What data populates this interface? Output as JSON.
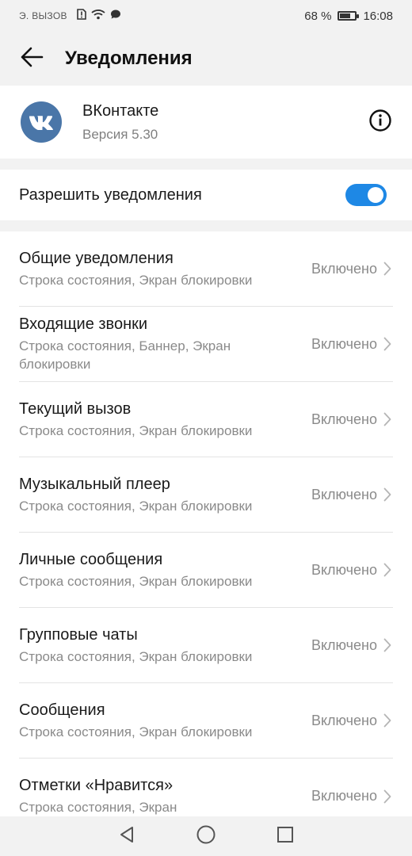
{
  "status_bar": {
    "call_text": "Э. ВЫЗОВ",
    "battery": "68 %",
    "battery_level": 0.68,
    "time": "16:08",
    "icons": [
      "alert-sim-icon",
      "wifi-icon",
      "message-icon"
    ]
  },
  "header": {
    "title": "Уведомления",
    "back_icon": "arrow-left-icon"
  },
  "app": {
    "name": "ВКонтакте",
    "version": "Версия 5.30",
    "icon": "vk-logo-icon",
    "info_icon": "info-icon",
    "brand_color": "#4a76a8"
  },
  "allow": {
    "label": "Разрешить уведомления",
    "enabled": true,
    "accent": "#1e88e5"
  },
  "items": [
    {
      "title": "Общие уведомления",
      "subtitle": "Строка состояния, Экран блокировки",
      "status": "Включено"
    },
    {
      "title": "Входящие звонки",
      "subtitle": "Строка состояния, Баннер, Экран блокировки",
      "status": "Включено"
    },
    {
      "title": "Текущий вызов",
      "subtitle": "Строка состояния, Экран блокировки",
      "status": "Включено"
    },
    {
      "title": "Музыкальный плеер",
      "subtitle": "Строка состояния, Экран блокировки",
      "status": "Включено"
    },
    {
      "title": "Личные сообщения",
      "subtitle": "Строка состояния, Экран блокировки",
      "status": "Включено"
    },
    {
      "title": "Групповые чаты",
      "subtitle": "Строка состояния, Экран блокировки",
      "status": "Включено"
    },
    {
      "title": "Сообщения",
      "subtitle": "Строка состояния, Экран блокировки",
      "status": "Включено"
    },
    {
      "title": "Отметки «Нравится»",
      "subtitle": "Строка состояния, Экран",
      "status": "Включено"
    }
  ],
  "nav": {
    "back": "nav-back-icon",
    "home": "nav-home-icon",
    "recents": "nav-recents-icon"
  }
}
